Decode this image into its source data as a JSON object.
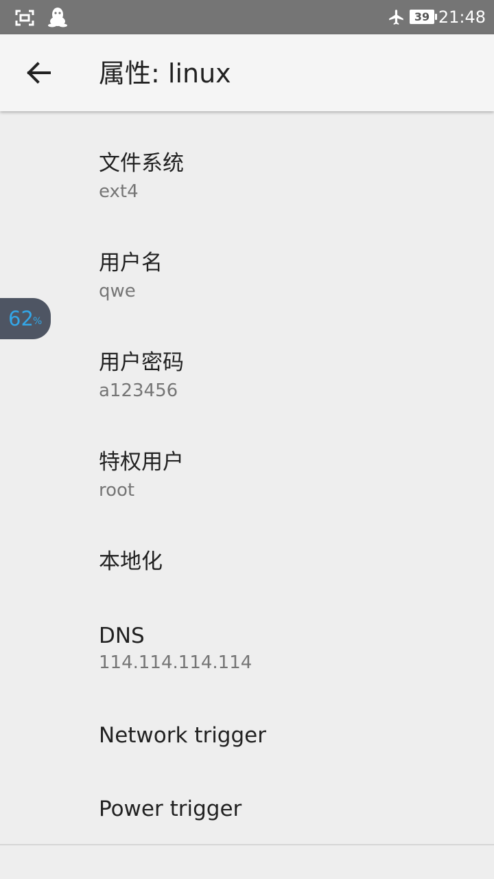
{
  "status_bar": {
    "time": "21:48",
    "battery_level": "39",
    "icons": [
      "screenshot-icon",
      "qq-penguin-icon",
      "airplane-mode-icon",
      "battery-icon"
    ]
  },
  "app_bar": {
    "title": "属性: linux",
    "back_icon": "arrow-back-icon"
  },
  "preferences": [
    {
      "title": "文件系统",
      "summary": "ext4"
    },
    {
      "title": "用户名",
      "summary": "qwe"
    },
    {
      "title": "用户密码",
      "summary": "a123456"
    },
    {
      "title": "特权用户",
      "summary": "root"
    },
    {
      "title": "本地化"
    },
    {
      "title": "DNS",
      "summary": "114.114.114.114"
    },
    {
      "title": "Network trigger"
    },
    {
      "title": "Power trigger"
    }
  ],
  "floating_widget": {
    "value": "62",
    "unit": "%",
    "color": "#33a7e8"
  },
  "colors": {
    "status_bar": "#757575",
    "app_bar": "#f5f5f5",
    "background": "#eeeeee",
    "title_text": "#212121",
    "summary_text": "#757575"
  }
}
